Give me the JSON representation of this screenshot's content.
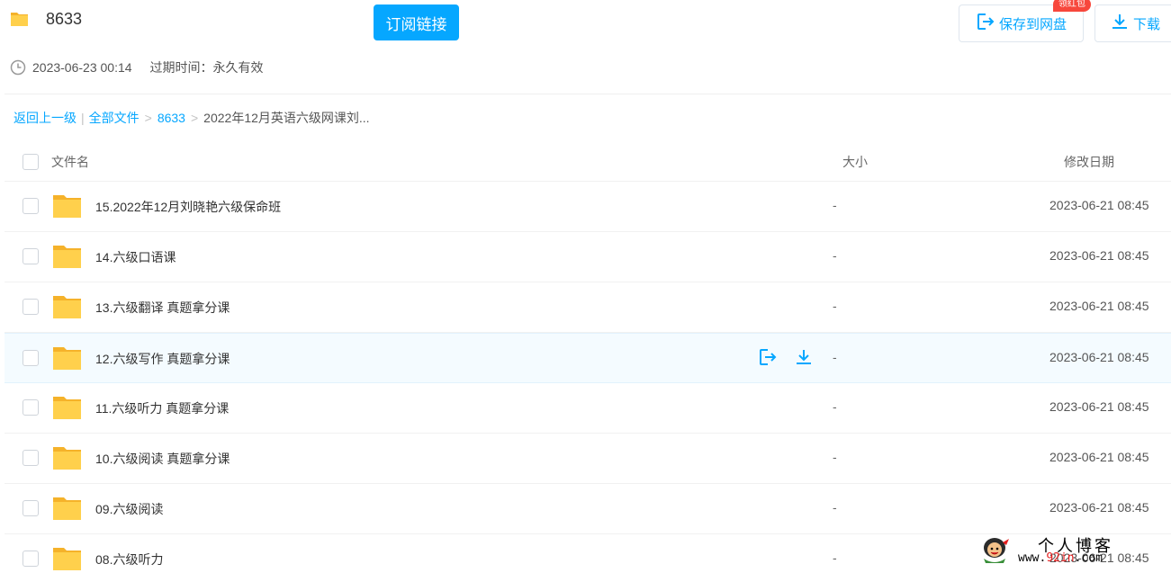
{
  "header": {
    "title": "8633",
    "subscribe_label": "订阅链接",
    "save_label": "保存到网盘",
    "download_label": "下载",
    "badge": "领红包"
  },
  "meta": {
    "created": "2023-06-23 00:14",
    "expire_label": "过期时间：",
    "expire_value": "永久有效"
  },
  "breadcrumb": {
    "back": "返回上一级",
    "bar": "|",
    "all_files": "全部文件",
    "sep": ">",
    "level1": "8633",
    "current": "2022年12月英语六级网课刘..."
  },
  "table": {
    "col_name": "文件名",
    "col_size": "大小",
    "col_date": "修改日期",
    "rows": [
      {
        "name": "15.2022年12月刘晓艳六级保命班",
        "size": "-",
        "date": "2023-06-21 08:45"
      },
      {
        "name": "14.六级口语课",
        "size": "-",
        "date": "2023-06-21 08:45"
      },
      {
        "name": "13.六级翻译 真题拿分课",
        "size": "-",
        "date": "2023-06-21 08:45"
      },
      {
        "name": "12.六级写作 真题拿分课",
        "size": "-",
        "date": "2023-06-21 08:45"
      },
      {
        "name": "11.六级听力 真题拿分课",
        "size": "-",
        "date": "2023-06-21 08:45"
      },
      {
        "name": "10.六级阅读 真题拿分课",
        "size": "-",
        "date": "2023-06-21 08:45"
      },
      {
        "name": "09.六级阅读",
        "size": "-",
        "date": "2023-06-21 08:45"
      },
      {
        "name": "08.六级听力",
        "size": "-",
        "date": "2023-06-21 08:45"
      }
    ]
  },
  "watermark": {
    "title": "个人博客",
    "url_prefix": "www.",
    "url_accent": "92in",
    "url_suffix": ".com"
  },
  "colors": {
    "accent": "#06a7ff",
    "folder": "#ffd04c",
    "badge": "#f7473c",
    "hover_row": "#f4fbff"
  },
  "icons": {
    "share": "folder-icon",
    "clock": "clock-icon",
    "save": "save-to-disk-icon",
    "download": "download-icon",
    "checkbox": "checkbox-icon"
  }
}
